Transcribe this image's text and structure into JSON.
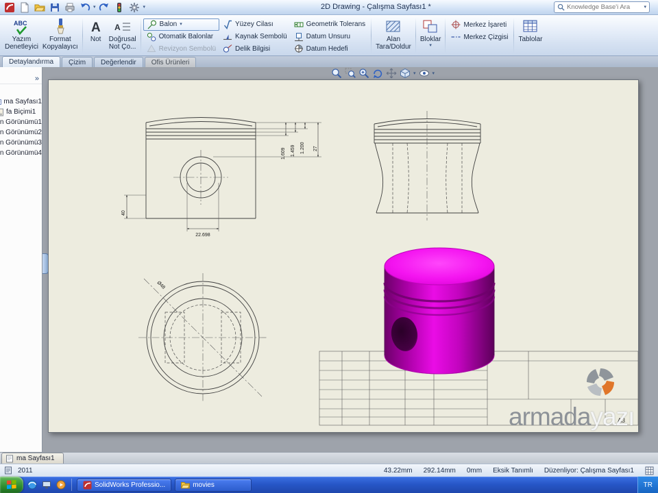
{
  "glyphs": {
    "dropdown": "▾",
    "collapse": "»",
    "abc": "ABC",
    "a": "A"
  },
  "titlebar": {
    "title": "2D Drawing - Çalışma Sayfası1 *",
    "search_placeholder": "Knowledge Base'i Ara"
  },
  "ribbon": {
    "large": [
      {
        "lines": [
          "Yazım",
          "Denetleyici"
        ]
      },
      {
        "lines": [
          "Format",
          "Kopyalayıcı"
        ]
      },
      {
        "lines": [
          "Not"
        ]
      },
      {
        "lines": [
          "Doğrusal",
          "Not Ço..."
        ]
      },
      {
        "lines": [
          "Alan",
          "Tara/Doldur"
        ]
      },
      {
        "lines": [
          "Bloklar"
        ]
      },
      {
        "lines": [
          "Tablolar"
        ]
      }
    ],
    "col_balloon": [
      "Balon",
      "Otomatik Balonlar",
      "Revizyon Sembolü"
    ],
    "col_symbols": [
      "Yüzey Cilası",
      "Kaynak Sembolü",
      "Delik Bilgisi"
    ],
    "col_datum": [
      "Geometrik Tolerans",
      "Datum Unsuru",
      "Datum Hedefi"
    ],
    "col_center": [
      "Merkez İşareti",
      "Merkez Çizgisi"
    ]
  },
  "tabs": [
    "Detaylandırma",
    "Çizim",
    "Değerlendir",
    "Ofis Ürünleri"
  ],
  "tree": {
    "items": [
      "ma Sayfası1",
      "fa Biçimi1",
      "n Görünümü1",
      "n Görünümü2",
      "n Görünümü3",
      "n Görünümü4"
    ]
  },
  "drawing": {
    "dims": {
      "width": "22.698",
      "groove1": "1.609",
      "groove2": "1.459",
      "groove3": "1.200",
      "height": "27",
      "skirt": "40",
      "dia": "Ø48"
    },
    "titleblock": {
      "size": "A3"
    }
  },
  "sheet_tab": {
    "label": "ma Sayfası1"
  },
  "statusbar": {
    "left": "2011",
    "x": "43.22mm",
    "y": "292.14mm",
    "z": "0mm",
    "state": "Eksik Tanımlı",
    "editing": "Düzenliyor: Çalışma Sayfası1"
  },
  "taskbar": {
    "tasks": [
      {
        "label": "SolidWorks Professio..."
      },
      {
        "label": "movies"
      }
    ],
    "tray_lang": "TR"
  },
  "watermark": {
    "part1": "armada",
    "part2": "yazı"
  }
}
